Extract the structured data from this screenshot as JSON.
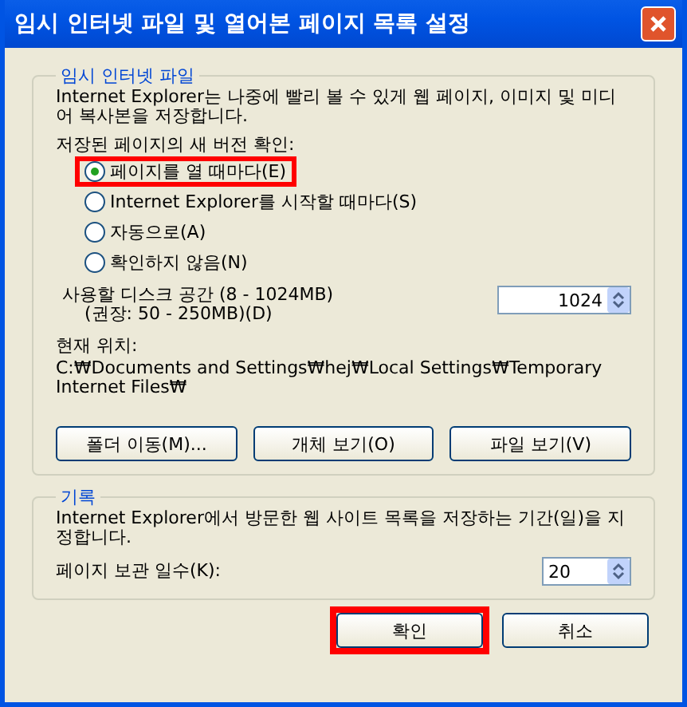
{
  "window": {
    "title": "임시 인터넷 파일 및 열어본 페이지 목록 설정"
  },
  "temp_files": {
    "legend": "임시 인터넷 파일",
    "description": "Internet Explorer는 나중에 빨리 볼 수 있게 웹 페이지, 이미지 및 미디어 복사본을 저장합니다.",
    "check_label": "저장된 페이지의 새 버전 확인:",
    "options": [
      {
        "label": "페이지를 열 때마다(E)",
        "selected": true,
        "highlighted": true
      },
      {
        "label": "Internet Explorer를 시작할 때마다(S)",
        "selected": false,
        "highlighted": false
      },
      {
        "label": "자동으로(A)",
        "selected": false,
        "highlighted": false
      },
      {
        "label": "확인하지 않음(N)",
        "selected": false,
        "highlighted": false
      }
    ],
    "disk_label": "사용할 디스크 공간 (8 - 1024MB)",
    "disk_hint": "(권장: 50 - 250MB)(D)",
    "disk_value": "1024",
    "location_label": "현재 위치:",
    "location": "C:₩Documents and Settings₩hej₩Local Settings₩Temporary Internet Files₩",
    "buttons": [
      "폴더 이동(M)...",
      "개체 보기(O)",
      "파일 보기(V)"
    ]
  },
  "history": {
    "legend": "기록",
    "description": "Internet Explorer에서 방문한 웹 사이트 목록을 저장하는 기간(일)을 지정합니다.",
    "days_label": "페이지 보관 일수(K):",
    "days_value": "20"
  },
  "footer_buttons": [
    {
      "label": "확인",
      "highlighted": true
    },
    {
      "label": "취소",
      "highlighted": false
    }
  ]
}
